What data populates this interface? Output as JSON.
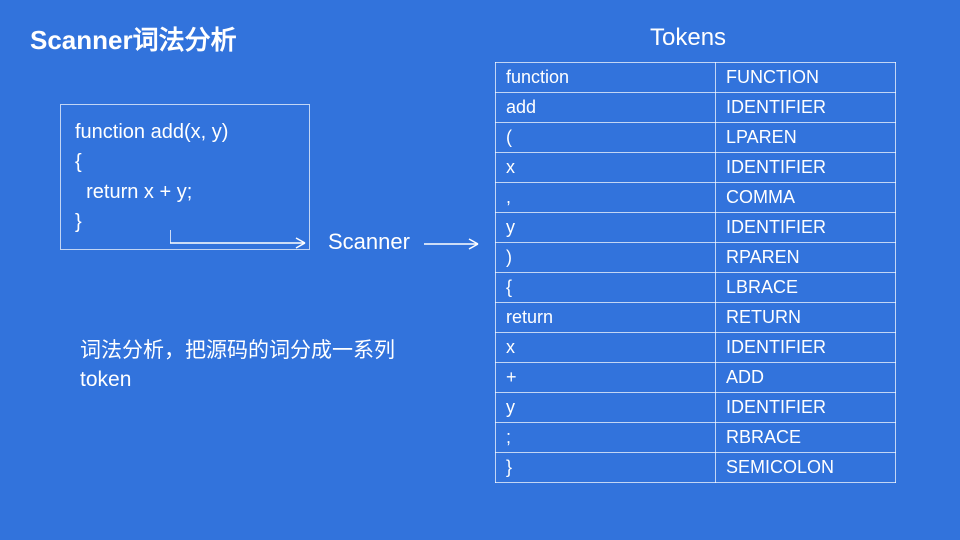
{
  "title": "Scanner词法分析",
  "tokens_header": "Tokens",
  "code": "function add(x, y)\n{\n  return x + y;\n}",
  "scanner_label": "Scanner",
  "description": "词法分析，把源码的词分成一系列token",
  "tokens": [
    {
      "lexeme": "function",
      "type": "FUNCTION"
    },
    {
      "lexeme": "add",
      "type": "IDENTIFIER"
    },
    {
      "lexeme": "(",
      "type": "LPAREN"
    },
    {
      "lexeme": "x",
      "type": "IDENTIFIER"
    },
    {
      "lexeme": ",",
      "type": "COMMA"
    },
    {
      "lexeme": "y",
      "type": "IDENTIFIER"
    },
    {
      "lexeme": ")",
      "type": "RPAREN"
    },
    {
      "lexeme": "{",
      "type": "LBRACE"
    },
    {
      "lexeme": "return",
      "type": "RETURN"
    },
    {
      "lexeme": "x",
      "type": "IDENTIFIER"
    },
    {
      "lexeme": "+",
      "type": "ADD"
    },
    {
      "lexeme": "y",
      "type": "IDENTIFIER"
    },
    {
      "lexeme": ";",
      "type": "RBRACE"
    },
    {
      "lexeme": "}",
      "type": "SEMICOLON"
    }
  ]
}
